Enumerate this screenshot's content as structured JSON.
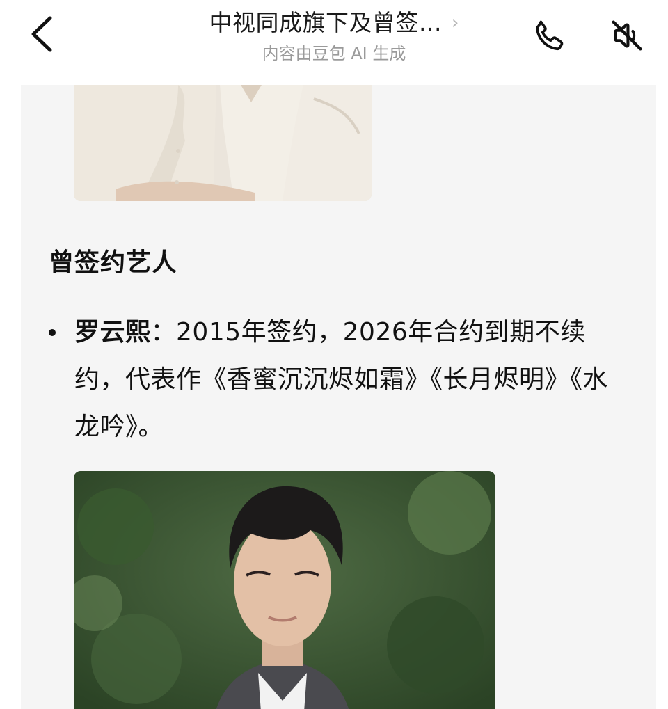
{
  "header": {
    "title": "中视同成旗下及曾签...",
    "title_chevron": "›",
    "subtitle": "内容由豆包 AI 生成",
    "icons": [
      "back-arrow-icon",
      "phone-icon",
      "speaker-muted-icon"
    ]
  },
  "content": {
    "section_heading": "曾签约艺人",
    "artists": [
      {
        "name": "罗云熙",
        "description": "：2015年签约，2026年合约到期不续约，代表作《香蜜沉沉烬如霜》《长月烬明》《水龙吟》。"
      }
    ]
  },
  "colors": {
    "card_background": "#f5f5f5",
    "text_primary": "#111111",
    "text_secondary": "#9a9a9a"
  }
}
